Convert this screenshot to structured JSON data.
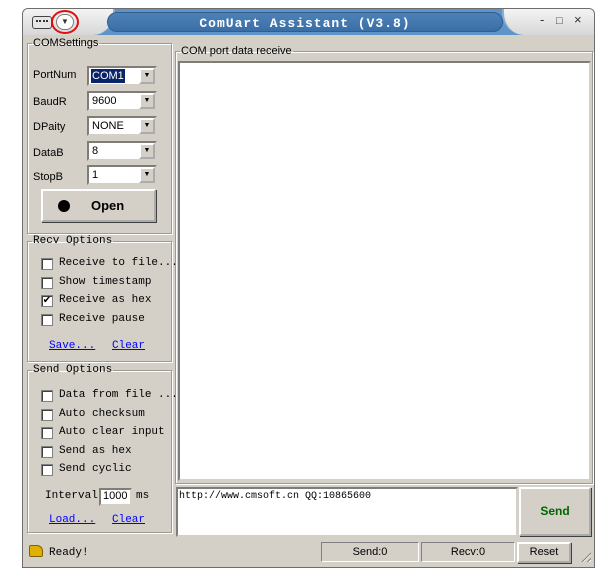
{
  "window": {
    "title": "ComUart Assistant (V3.8)",
    "controls": {
      "minimize": "-",
      "maximize": "□",
      "close": "×"
    },
    "menu_dropdown": "▼"
  },
  "com_settings": {
    "legend": "COMSettings",
    "fields": [
      {
        "label": "PortNum",
        "value": "COM1"
      },
      {
        "label": "BaudR",
        "value": "9600"
      },
      {
        "label": "DPaity",
        "value": "NONE"
      },
      {
        "label": "DataB",
        "value": "8"
      },
      {
        "label": "StopB",
        "value": "1"
      }
    ],
    "open_label": "Open"
  },
  "recv_options": {
    "legend": "Recv Options",
    "items": [
      {
        "label": "Receive to file...",
        "checked": false
      },
      {
        "label": "Show timestamp",
        "checked": false
      },
      {
        "label": "Receive as hex",
        "checked": true
      },
      {
        "label": "Receive pause",
        "checked": false
      }
    ],
    "save_link": "Save...",
    "clear_link": "Clear"
  },
  "send_options": {
    "legend": "Send Options",
    "items": [
      {
        "label": "Data from file ...",
        "checked": false
      },
      {
        "label": "Auto checksum",
        "checked": false
      },
      {
        "label": "Auto clear input",
        "checked": false
      },
      {
        "label": "Send as hex",
        "checked": false
      },
      {
        "label": "Send cyclic",
        "checked": false
      }
    ],
    "interval_label": "Interval",
    "interval_value": "1000",
    "interval_unit": "ms",
    "load_link": "Load...",
    "clear_link": "Clear"
  },
  "receive": {
    "legend": "COM port data receive",
    "content": ""
  },
  "send": {
    "input_text": "http://www.cmsoft.cn QQ:10865600",
    "send_label": "Send"
  },
  "status": {
    "ready": "Ready!",
    "send_count": "Send:0",
    "recv_count": "Recv:0",
    "reset_label": "Reset"
  },
  "icons": {
    "app": "serial-port-icon",
    "dropdown_arrow": "▼",
    "check": "✔",
    "ready": "pencil-icon"
  }
}
